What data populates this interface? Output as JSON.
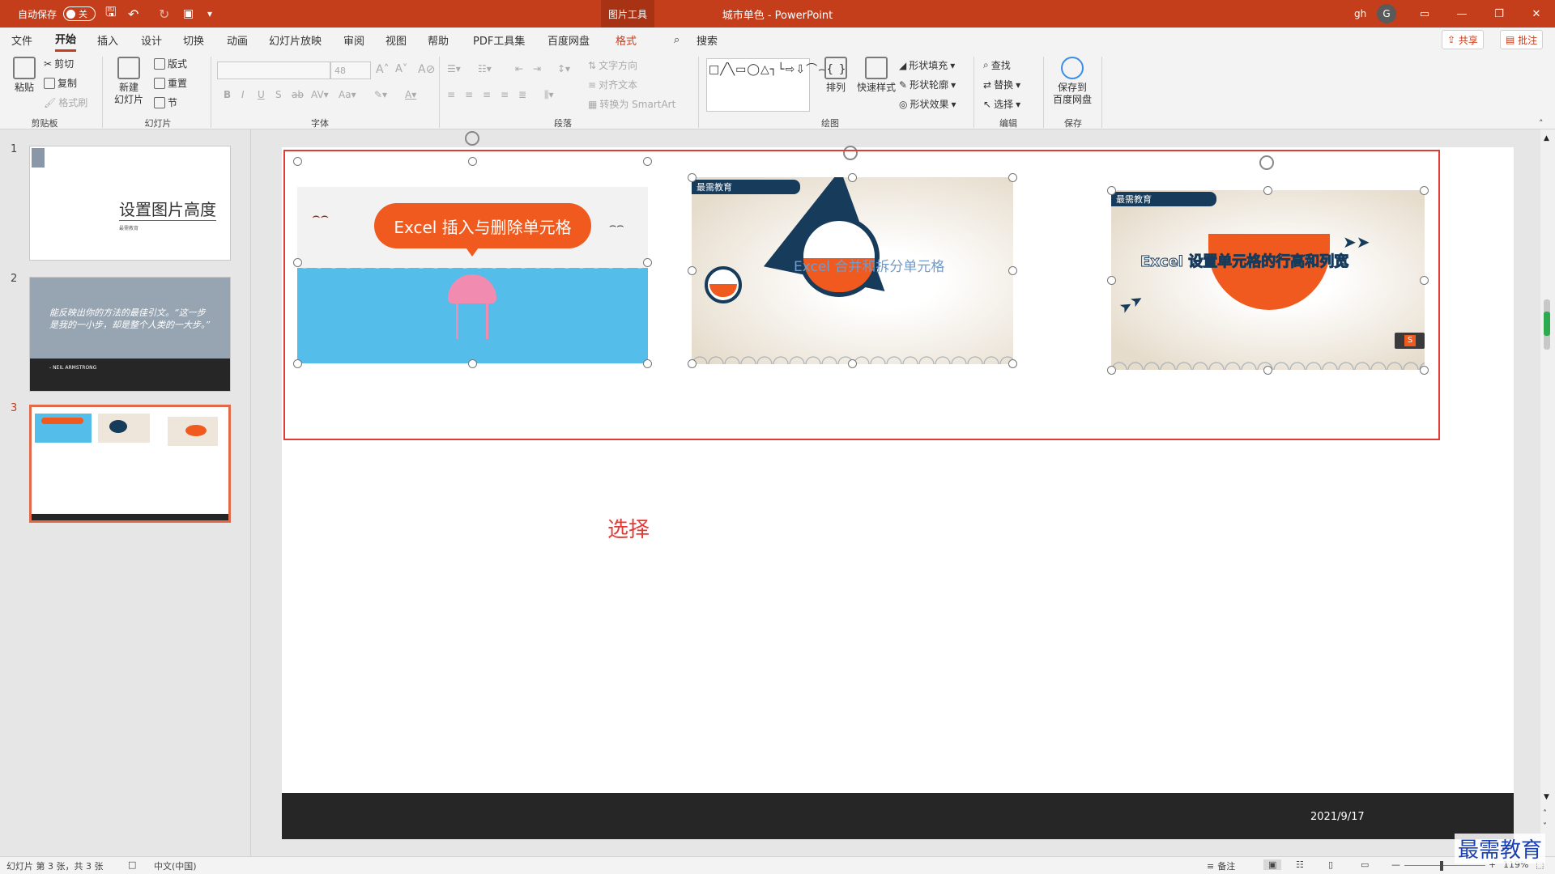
{
  "titlebar": {
    "autosave_label": "自动保存",
    "autosave_state": "关",
    "context_tab": "图片工具",
    "title": "城市单色  -  PowerPoint",
    "user": "gh",
    "user_initial": "G"
  },
  "menu": {
    "tabs": [
      "文件",
      "开始",
      "插入",
      "设计",
      "切换",
      "动画",
      "幻灯片放映",
      "审阅",
      "视图",
      "帮助",
      "PDF工具集",
      "百度网盘",
      "格式"
    ],
    "search": "搜索",
    "share": "共享",
    "comments": "批注"
  },
  "ribbon": {
    "clipboard": {
      "label": "剪贴板",
      "paste": "粘贴",
      "cut": "剪切",
      "copy": "复制",
      "format_painter": "格式刷"
    },
    "slides": {
      "label": "幻灯片",
      "new_slide": "新建\n幻灯片",
      "layout": "版式",
      "reset": "重置",
      "section": "节"
    },
    "font": {
      "label": "字体",
      "size": "48"
    },
    "paragraph": {
      "label": "段落",
      "text_direction": "文字方向",
      "align_text": "对齐文本",
      "smartart": "转换为 SmartArt"
    },
    "drawing": {
      "label": "绘图",
      "arrange": "排列",
      "quick_styles": "快速样式",
      "fill": "形状填充",
      "outline": "形状轮廓",
      "effects": "形状效果"
    },
    "editing": {
      "label": "编辑",
      "find": "查找",
      "replace": "替换",
      "select": "选择"
    },
    "save": {
      "label": "保存",
      "save_baidu": "保存到\n百度网盘"
    }
  },
  "slides_panel": {
    "items": [
      {
        "number": "1",
        "title": "设置图片高度",
        "subtitle": "最需教育"
      },
      {
        "number": "2",
        "quote": "能反映出你的方法的最佳引文。“这一步是我的一小步，却是整个人类的一大步。”",
        "author": "- NEIL ARMSTRONG"
      },
      {
        "number": "3"
      }
    ]
  },
  "slide": {
    "pictures": [
      {
        "caption": "Excel 插入与删除单元格"
      },
      {
        "badge": "最需教育",
        "caption": "Excel 合并和拆分单元格"
      },
      {
        "badge": "最需教育",
        "caption": "Excel 设置单元格的行高和列宽"
      }
    ],
    "annotation": "选择",
    "date": "2021/9/17"
  },
  "statusbar": {
    "slide_info": "幻灯片 第 3 张，共 3 张",
    "language": "中文(中国)",
    "notes": "备注",
    "zoom": "119%"
  },
  "watermark": "最需教育",
  "colors": {
    "accent": "#c43e1c",
    "selection_box": "#e53935",
    "navy": "#173b5a",
    "orange": "#f05a1e",
    "sea": "#55bde9"
  }
}
